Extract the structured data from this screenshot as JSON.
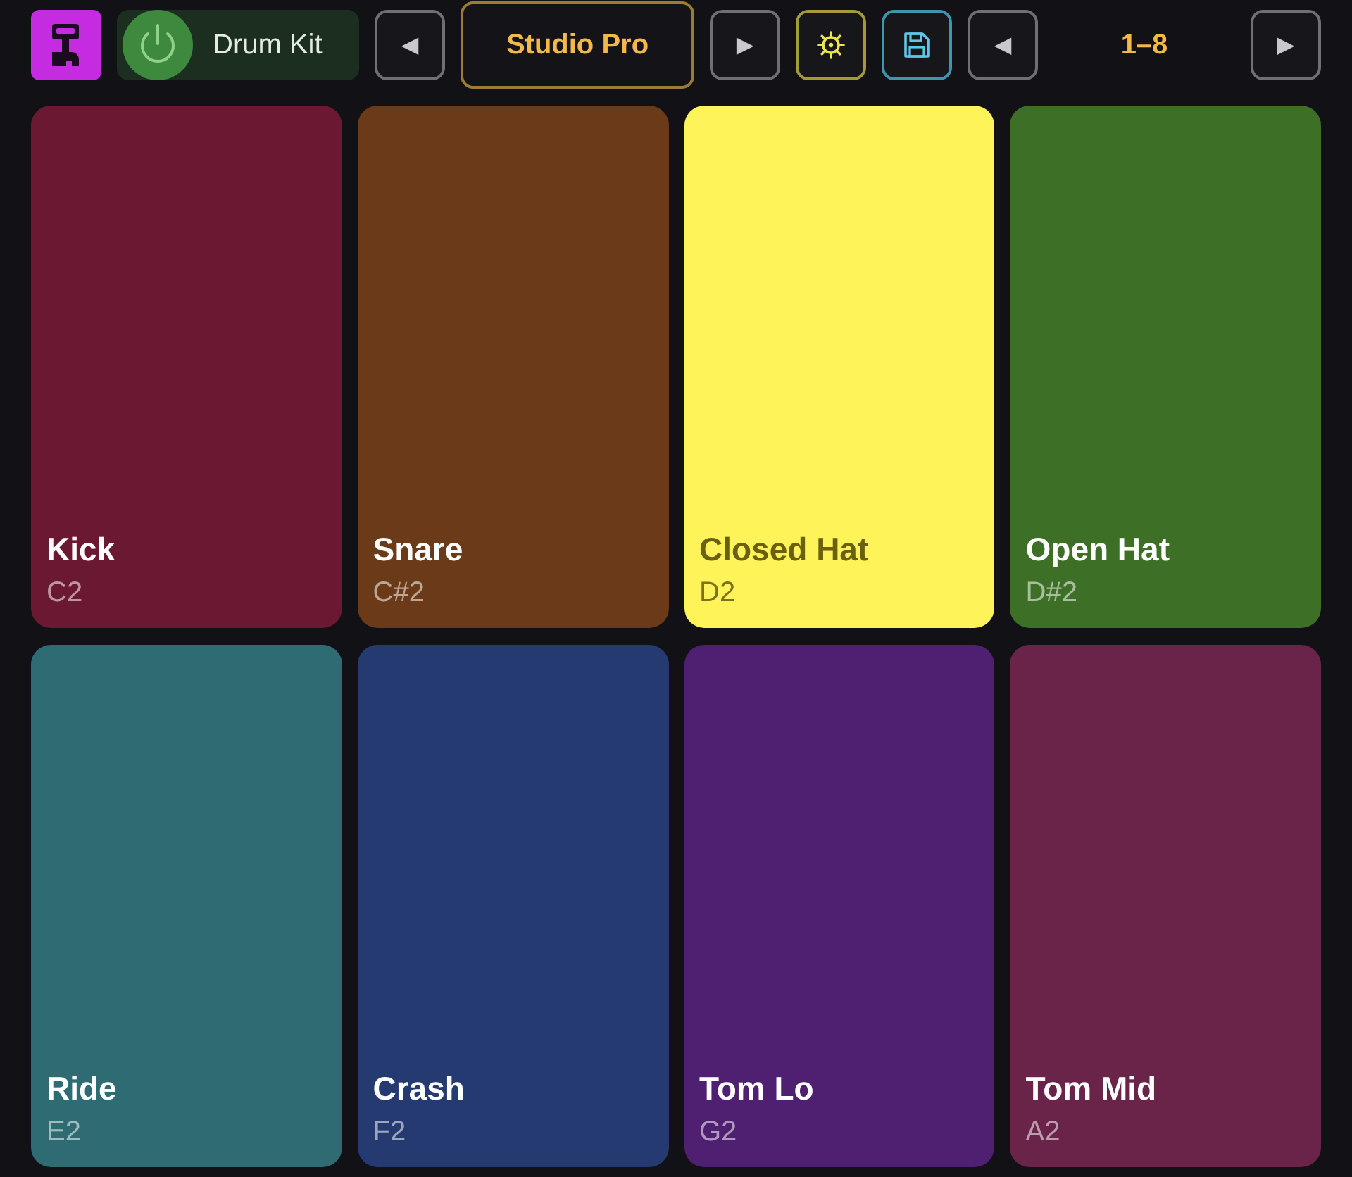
{
  "toolbar": {
    "power": {
      "on": true
    },
    "instrument": "Drum Kit",
    "prev_preset": "◀",
    "preset": "Studio Pro",
    "next_preset": "▶",
    "prev_page": "◀",
    "page_range": "1–8",
    "next_page": "▶"
  },
  "pads": [
    {
      "name": "Kick",
      "note": "C2",
      "color": "#6b1833"
    },
    {
      "name": "Snare",
      "note": "C#2",
      "color": "#6b3a18"
    },
    {
      "name": "Closed Hat",
      "note": "D2",
      "color": "#fff35a"
    },
    {
      "name": "Open Hat",
      "note": "D#2",
      "color": "#3d7026"
    },
    {
      "name": "Ride",
      "note": "E2",
      "color": "#2f6b72"
    },
    {
      "name": "Crash",
      "note": "F2",
      "color": "#263a72"
    },
    {
      "name": "Tom Lo",
      "note": "G2",
      "color": "#4f1f72"
    },
    {
      "name": "Tom Mid",
      "note": "A2",
      "color": "#6b2449"
    }
  ]
}
